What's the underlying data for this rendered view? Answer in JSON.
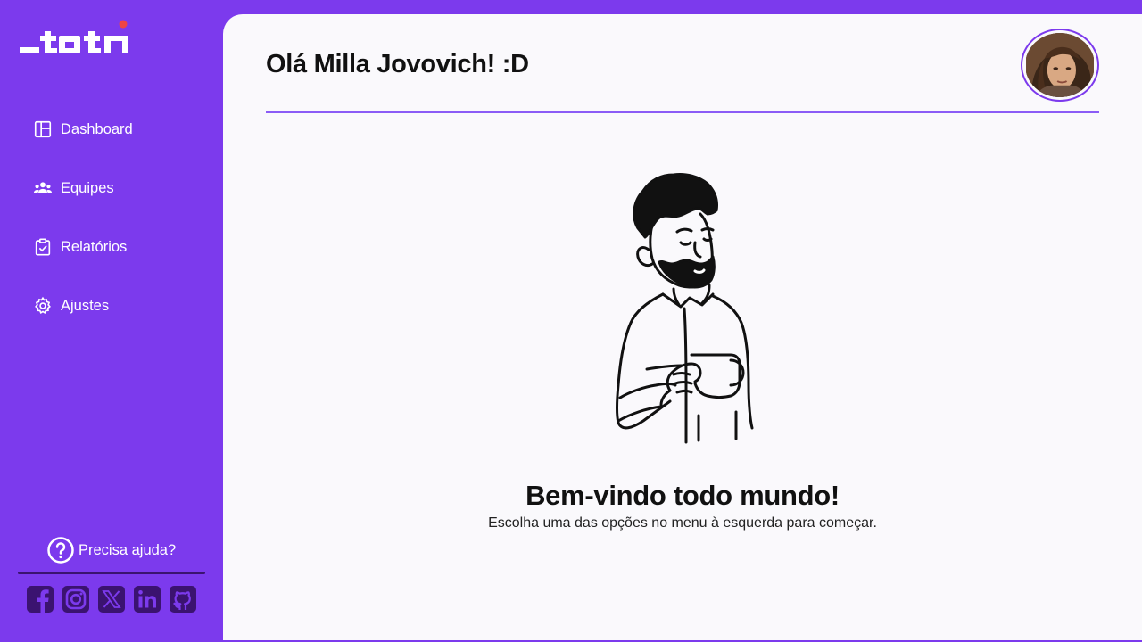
{
  "app": {
    "logo_text": "_toti"
  },
  "sidebar": {
    "items": [
      {
        "label": "Dashboard",
        "icon": "layout-icon"
      },
      {
        "label": "Equipes",
        "icon": "users-icon"
      },
      {
        "label": "Relatórios",
        "icon": "clipboard-check-icon"
      },
      {
        "label": "Ajustes",
        "icon": "gear-icon"
      }
    ],
    "help": {
      "label": "Precisa ajuda?",
      "icon": "question-circle-icon"
    },
    "socials": [
      "facebook-icon",
      "instagram-icon",
      "x-icon",
      "linkedin-icon",
      "github-icon"
    ]
  },
  "header": {
    "greeting": "Olá Milla Jovovich! :D"
  },
  "main": {
    "title": "Bem-vindo todo mundo!",
    "subtitle": "Escolha uma das opções no menu à esquerda para começar."
  },
  "colors": {
    "brand": "#7c3aed",
    "logo_dot": "#ef4444",
    "background": "#faf9fc",
    "social": "#3b1370"
  }
}
